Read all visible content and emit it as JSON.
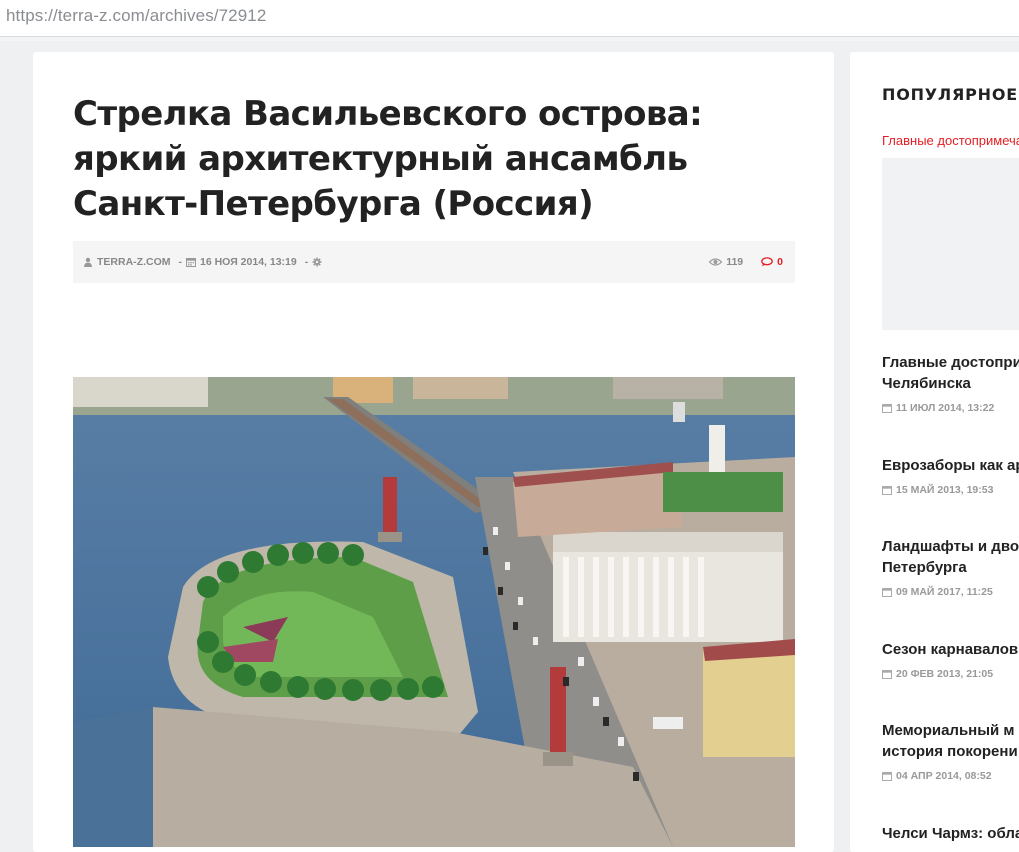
{
  "browser": {
    "url": "https://terra-z.com/archives/72912"
  },
  "article": {
    "title": "Стрелка Васильевского острова: яркий архитектурный ансамбль Санкт-Петербурга (Россия)",
    "meta": {
      "author": "TERRA-Z.COM",
      "date": "16 НОЯ 2014, 13:19",
      "views": "119",
      "comments": "0"
    },
    "image_alt": "Aerial view of the Spit of Vasilyevsky Island with rostral columns"
  },
  "sidebar": {
    "title": "ПОПУЛЯРНОЕ",
    "featured_link": "Главные достопримечательности Челябинска",
    "items": [
      {
        "title_line1": "Главные достопри",
        "title_line2": "Челябинска",
        "date": "11 ИЮЛ 2014, 13:22"
      },
      {
        "title_line1": "Еврозаборы как ар",
        "title_line2": "",
        "date": "15 МАЙ 2013, 19:53"
      },
      {
        "title_line1": "Ландшафты и дво",
        "title_line2": "Петербурга",
        "date": "09 МАЙ 2017, 11:25"
      },
      {
        "title_line1": "Сезон карнавалов",
        "title_line2": "",
        "date": "20 ФЕВ 2013, 21:05"
      },
      {
        "title_line1": "Мемориальный м",
        "title_line2": "история покорени",
        "date": "04 АПР 2014, 08:52"
      },
      {
        "title_line1": "Челси Чармз: обла",
        "title_line2": "",
        "date": ""
      }
    ]
  },
  "colors": {
    "accent": "#e31e24",
    "text": "#222222",
    "muted": "#888888",
    "page_bg": "#eef0f2"
  }
}
